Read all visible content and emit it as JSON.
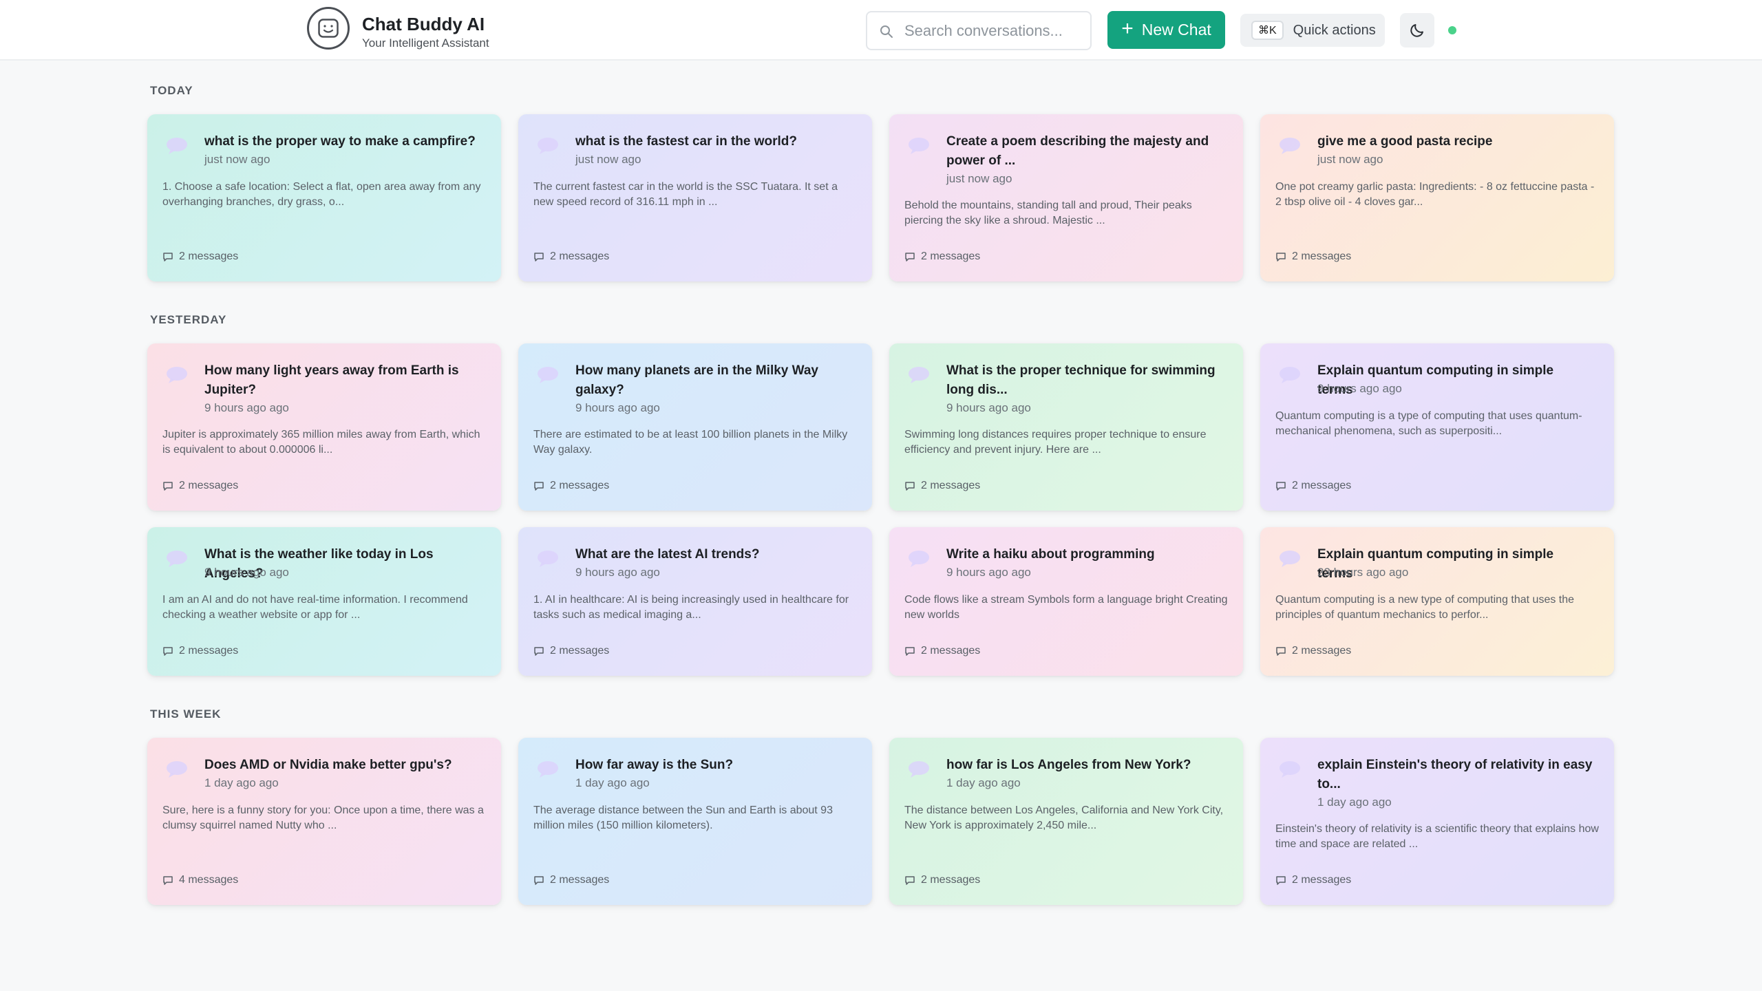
{
  "header": {
    "brand_title": "Chat Buddy AI",
    "brand_subtitle": "Your Intelligent Assistant",
    "search_placeholder": "Search conversations...",
    "new_chat_label": "New Chat",
    "quick_shortcut": "⌘K",
    "quick_label": "Quick actions",
    "status_color": "#4ad28a",
    "accent_color": "#14a37f"
  },
  "sections": [
    {
      "label": "TODAY",
      "cards": [
        {
          "title": "what is the proper way to make a campfire?",
          "time": "just now ago",
          "preview": "1. Choose a safe location: Select a flat, open area away from any overhanging branches, dry grass, o...",
          "count": "2 messages"
        },
        {
          "title": "what is the fastest car in the world?",
          "time": "just now ago",
          "preview": "The current fastest car in the world is the SSC Tuatara. It set a new speed record of 316.11 mph in ...",
          "count": "2 messages"
        },
        {
          "title": "Create a poem describing the majesty and power of ...",
          "time": "just now ago",
          "preview": "Behold the mountains, standing tall and proud, Their peaks piercing the sky like a shroud. Majestic ...",
          "count": "2 messages"
        },
        {
          "title": "give me a good pasta recipe",
          "time": "just now ago",
          "preview": "One pot creamy garlic pasta: Ingredients: - 8 oz fettuccine pasta - 2 tbsp olive oil - 4 cloves gar...",
          "count": "2 messages"
        }
      ]
    },
    {
      "label": "YESTERDAY",
      "cards": [
        {
          "title": "How many light years away from Earth is Jupiter?",
          "time": "9 hours ago ago",
          "preview": "Jupiter is approximately 365 million miles away from Earth, which is equivalent to about 0.000006 li...",
          "count": "2 messages"
        },
        {
          "title": "How many planets are in the Milky Way galaxy?",
          "time": "9 hours ago ago",
          "preview": "There are estimated to be at least 100 billion planets in the Milky Way galaxy.",
          "count": "2 messages"
        },
        {
          "title": "What is the proper technique for swimming long dis...",
          "time": "9 hours ago ago",
          "preview": "Swimming long distances requires proper technique to ensure efficiency and prevent injury. Here are ...",
          "count": "2 messages"
        },
        {
          "title": "Explain quantum computing in simple terms",
          "time": "9 hours ago ago",
          "preview": "Quantum computing is a type of computing that uses quantum-mechanical phenomena, such as superpositi...",
          "count": "2 messages"
        },
        {
          "title": "What is the weather like today in Los Angeles?",
          "time": "9 hours ago ago",
          "preview": "I am an AI and do not have real-time information. I recommend checking a weather website or app for ...",
          "count": "2 messages"
        },
        {
          "title": "What are the latest AI trends?",
          "time": "9 hours ago ago",
          "preview": "1. AI in healthcare: AI is being increasingly used in healthcare for tasks such as medical imaging a...",
          "count": "2 messages"
        },
        {
          "title": "Write a haiku about programming",
          "time": "9 hours ago ago",
          "preview": "Code flows like a stream Symbols form a language bright Creating new worlds",
          "count": "2 messages"
        },
        {
          "title": "Explain quantum computing in simple terms",
          "time": "23 hours ago ago",
          "preview": "Quantum computing is a new type of computing that uses the principles of quantum mechanics to perfor...",
          "count": "2 messages"
        }
      ]
    },
    {
      "label": "THIS WEEK",
      "cards": [
        {
          "title": "Does AMD or Nvidia make better gpu's?",
          "time": "1 day ago ago",
          "preview": "Sure, here is a funny story for you: Once upon a time, there was a clumsy squirrel named Nutty who ...",
          "count": "4 messages"
        },
        {
          "title": "How far away is the Sun?",
          "time": "1 day ago ago",
          "preview": "The average distance between the Sun and Earth is about 93 million miles (150 million kilometers).",
          "count": "2 messages"
        },
        {
          "title": "how far is Los Angeles from New York?",
          "time": "1 day ago ago",
          "preview": "The distance between Los Angeles, California and New York City, New York is approximately 2,450 mile...",
          "count": "2 messages"
        },
        {
          "title": "explain Einstein's theory of relativity in easy to...",
          "time": "1 day ago ago",
          "preview": "Einstein's theory of relativity is a scientific theory that explains how time and space are related ...",
          "count": "2 messages"
        }
      ]
    }
  ]
}
